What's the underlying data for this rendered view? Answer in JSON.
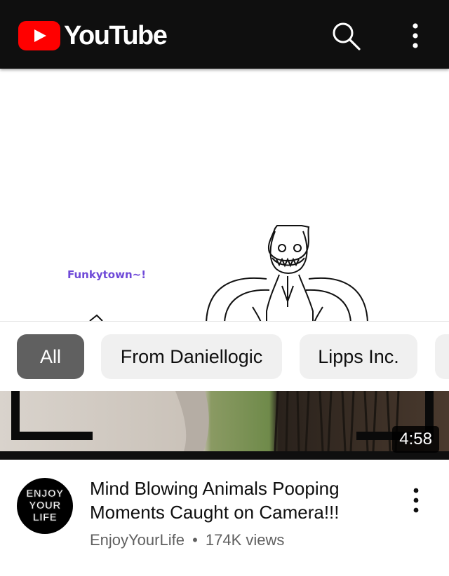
{
  "app": {
    "brand": "YouTube",
    "accent_color": "#ff0000"
  },
  "topbar": {
    "icons": [
      "search-icon",
      "more-vert-icon"
    ]
  },
  "preview": {
    "caption": "Funkytown~!"
  },
  "chips": [
    {
      "label": "All",
      "active": true
    },
    {
      "label": "From Daniellogic",
      "active": false
    },
    {
      "label": "Lipps Inc.",
      "active": false
    },
    {
      "label": "",
      "active": false
    }
  ],
  "video": {
    "duration": "4:58",
    "title": "Mind Blowing Animals Pooping Moments Caught on Camera!!!",
    "channel": "EnjoyYourLife",
    "separator": "•",
    "views": "174K views",
    "avatar_text": [
      "ENJOY",
      "YOUR",
      "LIFE"
    ]
  }
}
